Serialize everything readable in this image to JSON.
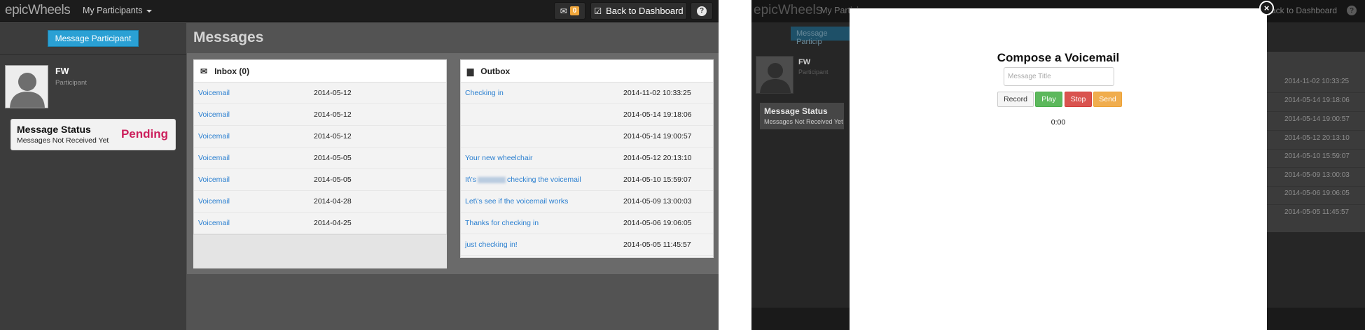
{
  "left": {
    "brand": "epicWheels",
    "nav_label": "My Participants",
    "mail_count": "0",
    "back_label": "Back to Dashboard",
    "help_glyph": "?",
    "message_participant_label": "Message Participant",
    "participant": {
      "name": "FW",
      "role": "Participant"
    },
    "status": {
      "title": "Message Status",
      "subtitle": "Messages Not Received Yet",
      "state": "Pending"
    },
    "page_title": "Messages",
    "inbox": {
      "title": "Inbox (0)",
      "rows": [
        {
          "title": "Voicemail",
          "date": "2014-05-12"
        },
        {
          "title": "Voicemail",
          "date": "2014-05-12"
        },
        {
          "title": "Voicemail",
          "date": "2014-05-12"
        },
        {
          "title": "Voicemail",
          "date": "2014-05-05"
        },
        {
          "title": "Voicemail",
          "date": "2014-05-05"
        },
        {
          "title": "Voicemail",
          "date": "2014-04-28"
        },
        {
          "title": "Voicemail",
          "date": "2014-04-25"
        }
      ]
    },
    "outbox": {
      "title": "Outbox",
      "rows": [
        {
          "title": "Checking in",
          "date": "2014-11-02 10:33:25"
        },
        {
          "title": "",
          "date": "2014-05-14 19:18:06"
        },
        {
          "title": "",
          "date": "2014-05-14 19:00:57"
        },
        {
          "title": "Your new wheelchair",
          "date": "2014-05-12 20:13:10"
        },
        {
          "title_before": "It\\'s",
          "title_after": "checking the voicemail",
          "date": "2014-05-10 15:59:07"
        },
        {
          "title": "Let\\'s see if the voicemail works",
          "date": "2014-05-09 13:00:03"
        },
        {
          "title": "Thanks for checking in",
          "date": "2014-05-06 19:06:05"
        },
        {
          "title": "just checking in!",
          "date": "2014-05-05 11:45:57"
        }
      ]
    }
  },
  "right": {
    "brand": "epicWheels",
    "nav_label": "My Partici",
    "back_label": "ack to Dashboard",
    "message_participant_label": "Message Particip",
    "participant": {
      "name": "FW",
      "role": "Participant"
    },
    "status": {
      "title": "Message Status",
      "subtitle": "Messages Not Received Yet"
    },
    "dates": [
      "2014-11-02 10:33:25",
      "2014-05-14 19:18:06",
      "2014-05-14 19:00:57",
      "2014-05-12 20:13:10",
      "2014-05-10 15:59:07",
      "2014-05-09 13:00:03",
      "2014-05-06 19:06:05",
      "2014-05-05 11:45:57"
    ],
    "modal": {
      "title": "Compose a Voicemail",
      "input_placeholder": "Message Title",
      "buttons": {
        "record": "Record",
        "play": "Play",
        "stop": "Stop",
        "send": "Send"
      },
      "timer": "0:00",
      "close_glyph": "×"
    }
  },
  "icons": {
    "mail": "envelope-icon",
    "check": "check-square-icon",
    "help": "question-circle-icon",
    "inbox": "envelope-icon",
    "outbox": "folder-icon",
    "close": "close-icon"
  },
  "colors": {
    "accent_blue": "#2aa0d4",
    "link_blue": "#2a7fd0",
    "pending_red": "#cc1f5c",
    "badge_orange": "#f0a63b",
    "play_green": "#5cb85c",
    "stop_red": "#d9534f",
    "send_orange": "#f0ad4e"
  }
}
